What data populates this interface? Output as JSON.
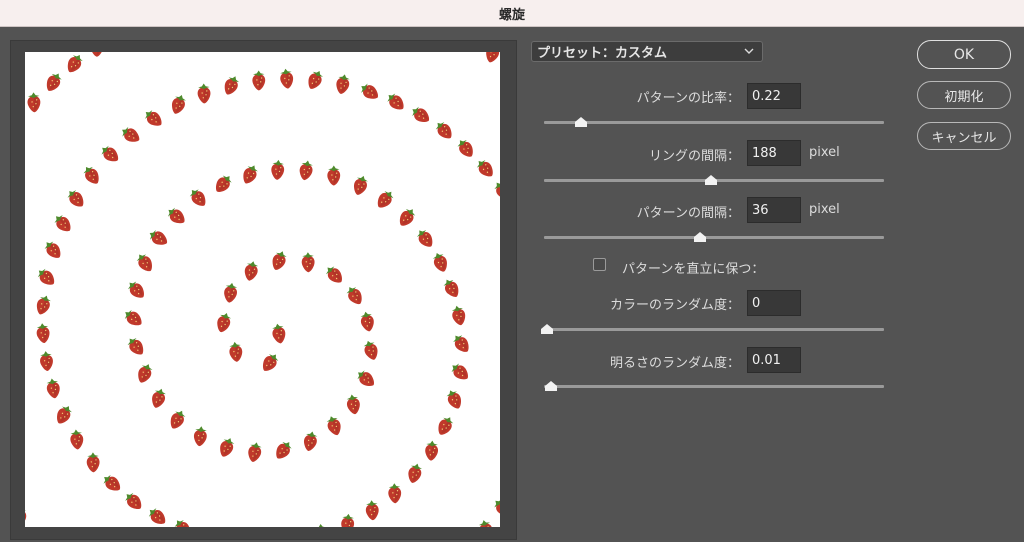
{
  "window": {
    "title": "螺旋"
  },
  "preview": {
    "description_icon": "strawberry-icon"
  },
  "preset": {
    "label": "プリセット：カスタム",
    "icon": "chevron-down-icon"
  },
  "controls": {
    "pattern_ratio": {
      "label": "パターンの比率：",
      "value": "0.22",
      "slider_position": 0.11
    },
    "ring_spacing": {
      "label": "リングの間隔：",
      "value": "188",
      "unit": "pixel",
      "slider_position": 0.49
    },
    "pattern_spacing": {
      "label": "パターンの間隔：",
      "value": "36",
      "unit": "pixel",
      "slider_position": 0.46
    },
    "keep_upright": {
      "label": "パターンを直立に保つ：",
      "checked": false
    },
    "color_random": {
      "label": "カラーのランダム度：",
      "value": "0",
      "slider_position": 0.01
    },
    "brightness_random": {
      "label": "明るさのランダム度：",
      "value": "0.01",
      "slider_position": 0.02
    }
  },
  "buttons": {
    "ok": "OK",
    "reset": "初期化",
    "cancel": "キャンセル"
  },
  "colors": {
    "dialog_bg": "#535353",
    "title_bar_bg": "#f7efee",
    "strawberry": "#c0392b",
    "leaf": "#4e8a2c"
  }
}
